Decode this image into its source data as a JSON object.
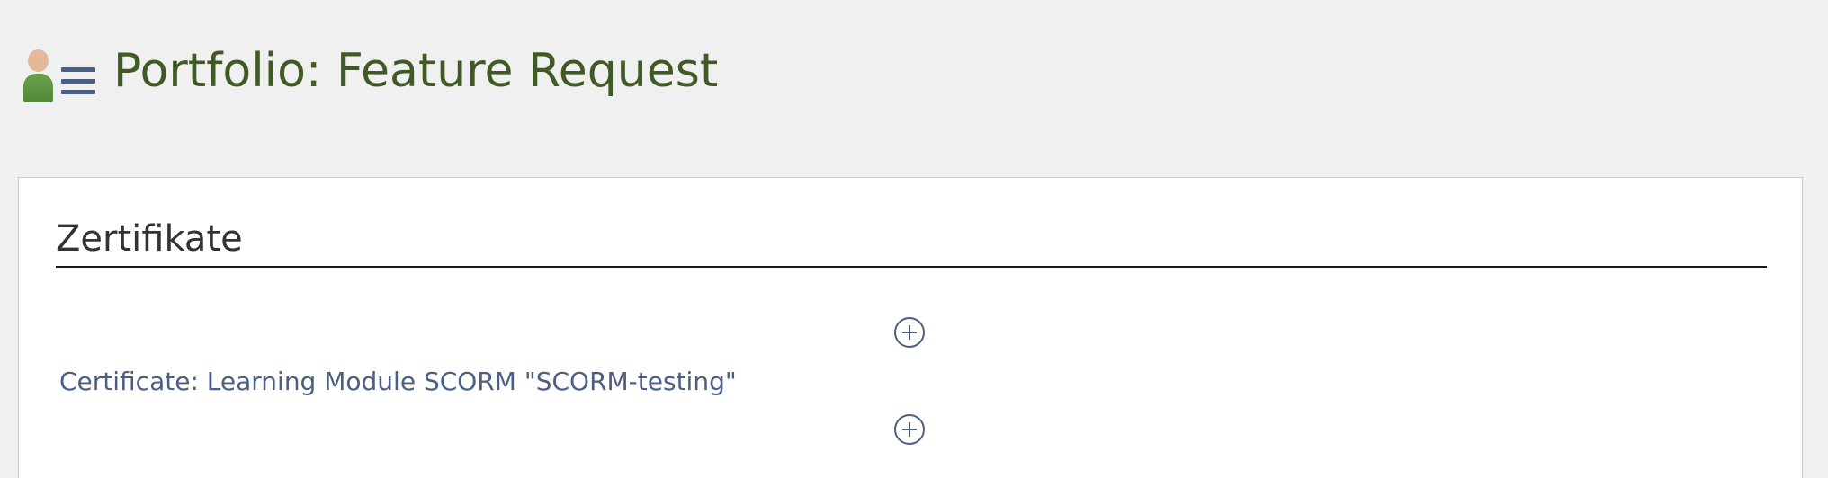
{
  "header": {
    "title": "Portfolio: Feature Request",
    "avatar_icon": "user-avatar-icon",
    "menu_icon": "hamburger-menu-icon"
  },
  "section": {
    "title": "Zertifikate",
    "add_icon": "plus-circle-icon",
    "items": [
      {
        "label": "Certificate: Learning Module SCORM \"SCORM-testing\""
      }
    ]
  },
  "colors": {
    "background": "#f0f0f0",
    "title_green": "#3f5a25",
    "link_blue": "#4b5e84",
    "panel_bg": "#ffffff"
  }
}
